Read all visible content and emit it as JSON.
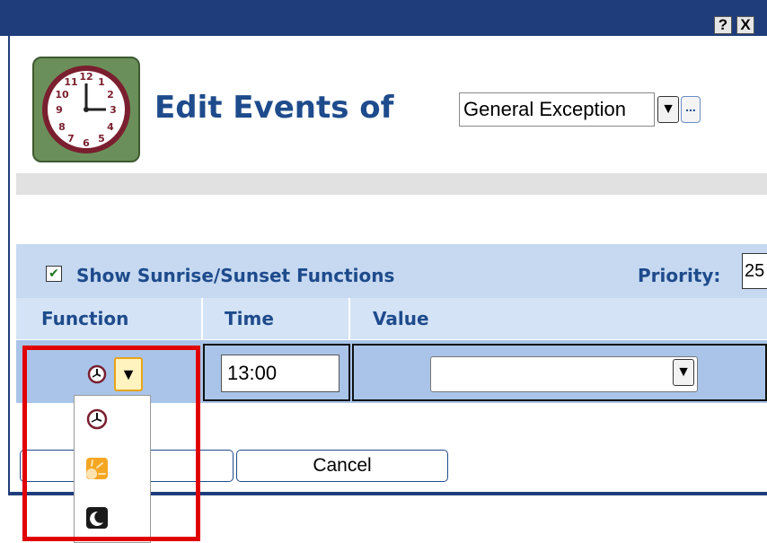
{
  "window": {
    "help_button": "?",
    "close_button": "X"
  },
  "header": {
    "title": "Edit Events of",
    "calendar_select_value": "General Exception",
    "dropdown_arrow": "▼",
    "more_button": "..."
  },
  "options": {
    "show_sun_label": "Show Sunrise/Sunset Functions",
    "show_sun_checked": true,
    "checkmark": "✔",
    "priority_label": "Priority:",
    "priority_value": "25"
  },
  "table": {
    "columns": [
      "Function",
      "Time",
      "Value"
    ],
    "row": {
      "function_icon": "clock-icon",
      "dropdown_arrow": "▼",
      "time": "13:00",
      "value": "",
      "value_dropdown_arrow": "▼"
    }
  },
  "function_menu": {
    "options": [
      "clock-icon",
      "sunrise-icon",
      "sunset-moon-icon"
    ]
  },
  "buttons": {
    "ok": "",
    "cancel": "Cancel"
  },
  "colors": {
    "title_bar": "#1f3d7a",
    "heading": "#1e4b8c",
    "options_bar": "#c6d9f1",
    "row_bar": "#a9c4e8",
    "highlight": "#e00000",
    "sun": "#f5a623"
  }
}
